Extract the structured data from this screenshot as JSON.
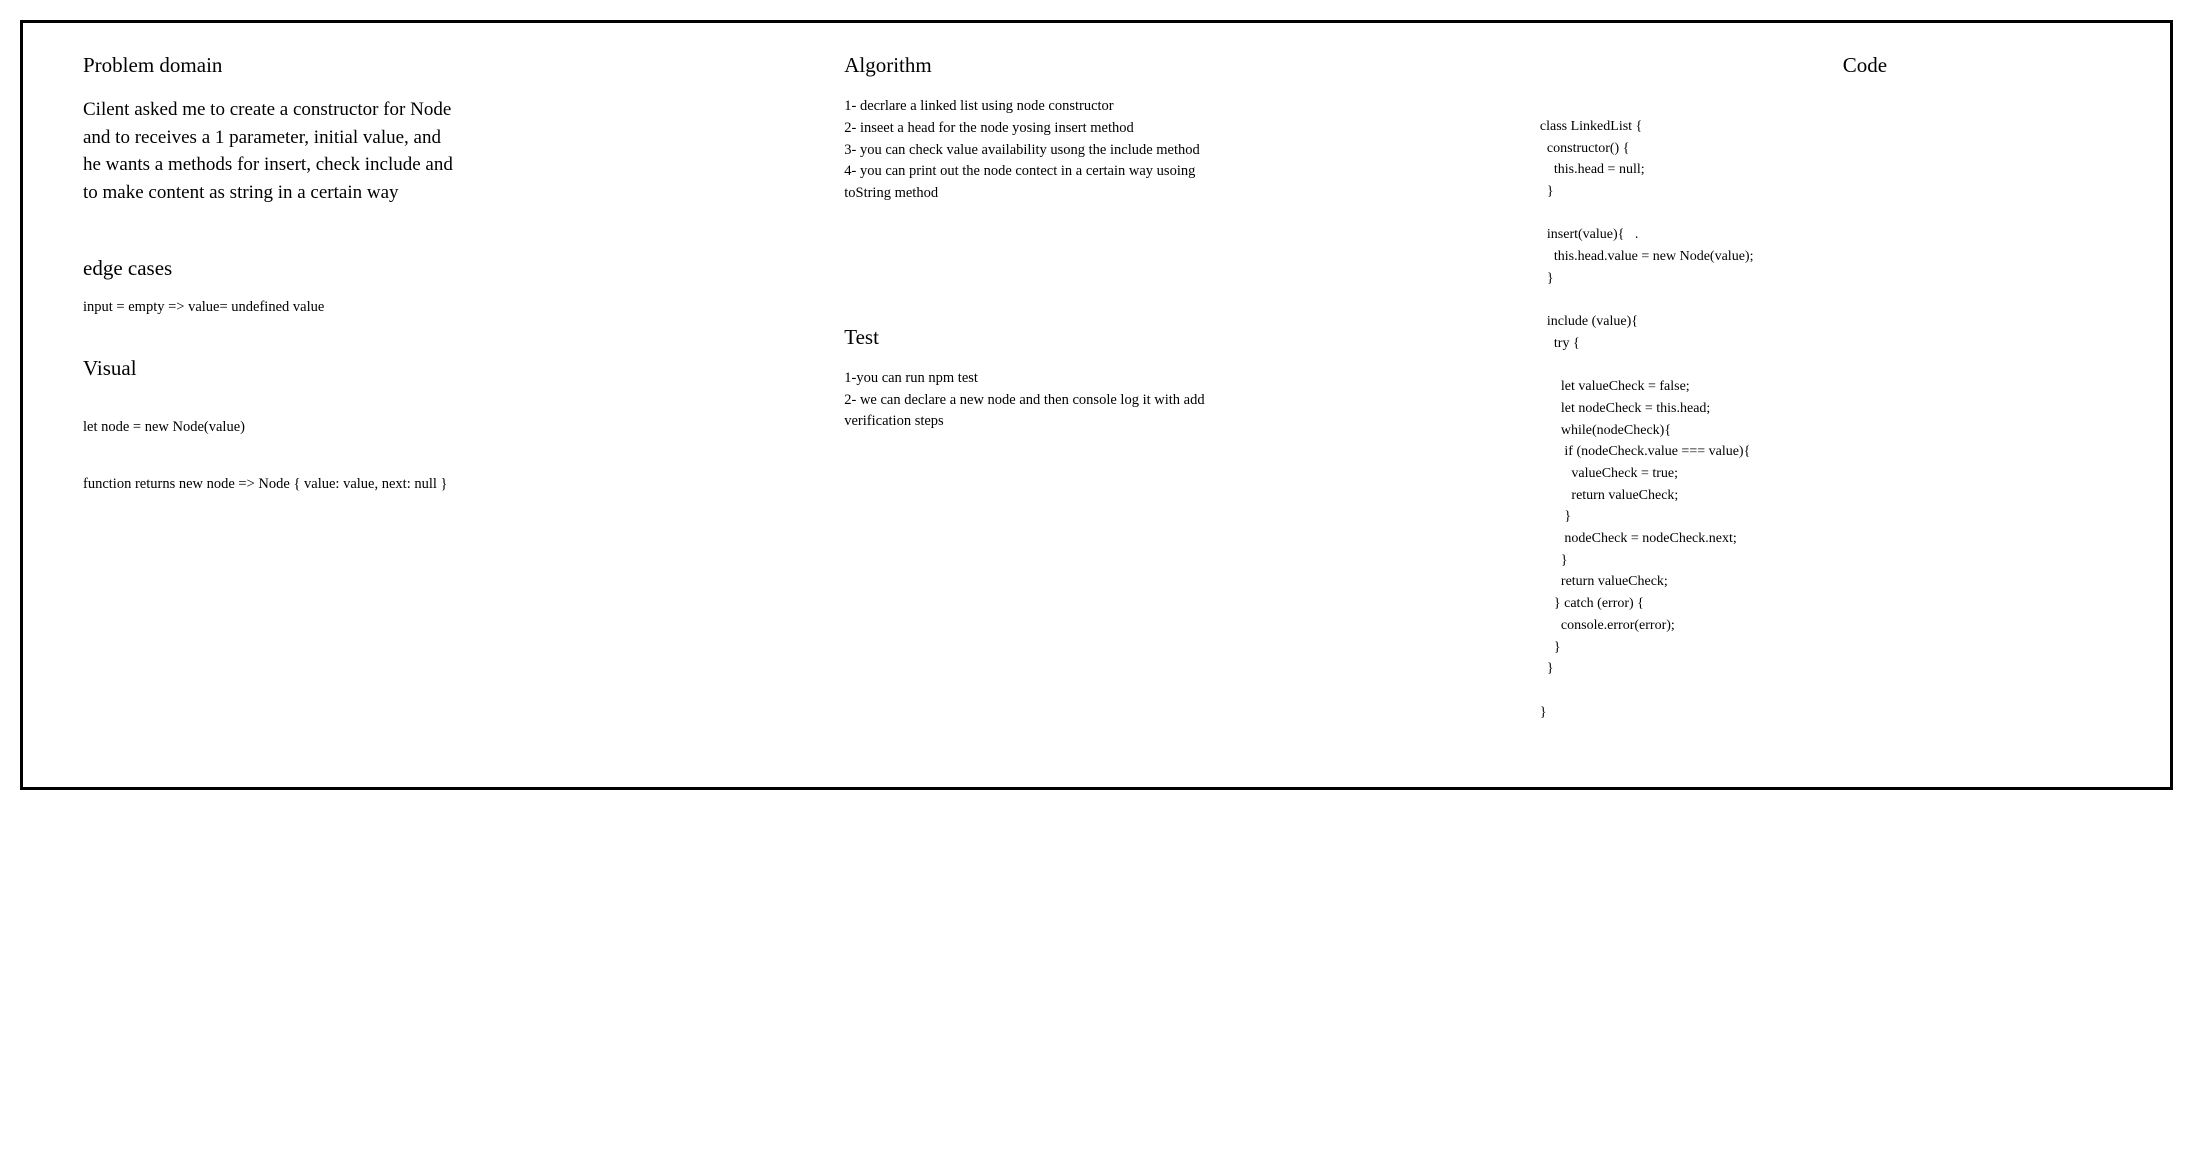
{
  "col1": {
    "problem_heading": "Problem domain",
    "problem_body": "Cilent asked me to create a constructor for Node and to receives a 1 parameter, initial value, and he wants a methods for insert, check include and to make content as string in a certain way",
    "edge_heading": "edge cases",
    "edge_body": "input = empty => value= undefined value",
    "visual_heading": "Visual",
    "visual_line1": "let node = new Node(value)",
    "visual_line2": "function returns new node =>  Node { value: value, next: null }"
  },
  "col2": {
    "algo_heading": "Algorithm",
    "algo_body": "1- decrlare a linked list using node constructor\n2- inseet a head for the node yosing insert method\n3- you can check value availability usong the include method\n4- you can print out the node contect in a certain way usoing toString method",
    "test_heading": "Test",
    "test_body": "1-you can run npm test\n2- we can declare a new node and then console log it with add verification steps"
  },
  "col3": {
    "code_heading": "Code",
    "code_body": "class LinkedList {\n  constructor() {\n    this.head = null;\n  }\n\n  insert(value){   .\n    this.head.value = new Node(value);\n  }\n\n  include (value){\n    try {\n\n      let valueCheck = false;\n      let nodeCheck = this.head;\n      while(nodeCheck){\n       if (nodeCheck.value === value){\n         valueCheck = true;\n         return valueCheck;\n       }\n       nodeCheck = nodeCheck.next;\n      }\n      return valueCheck;\n    } catch (error) {\n      console.error(error);\n    }\n  }\n\n}"
  }
}
